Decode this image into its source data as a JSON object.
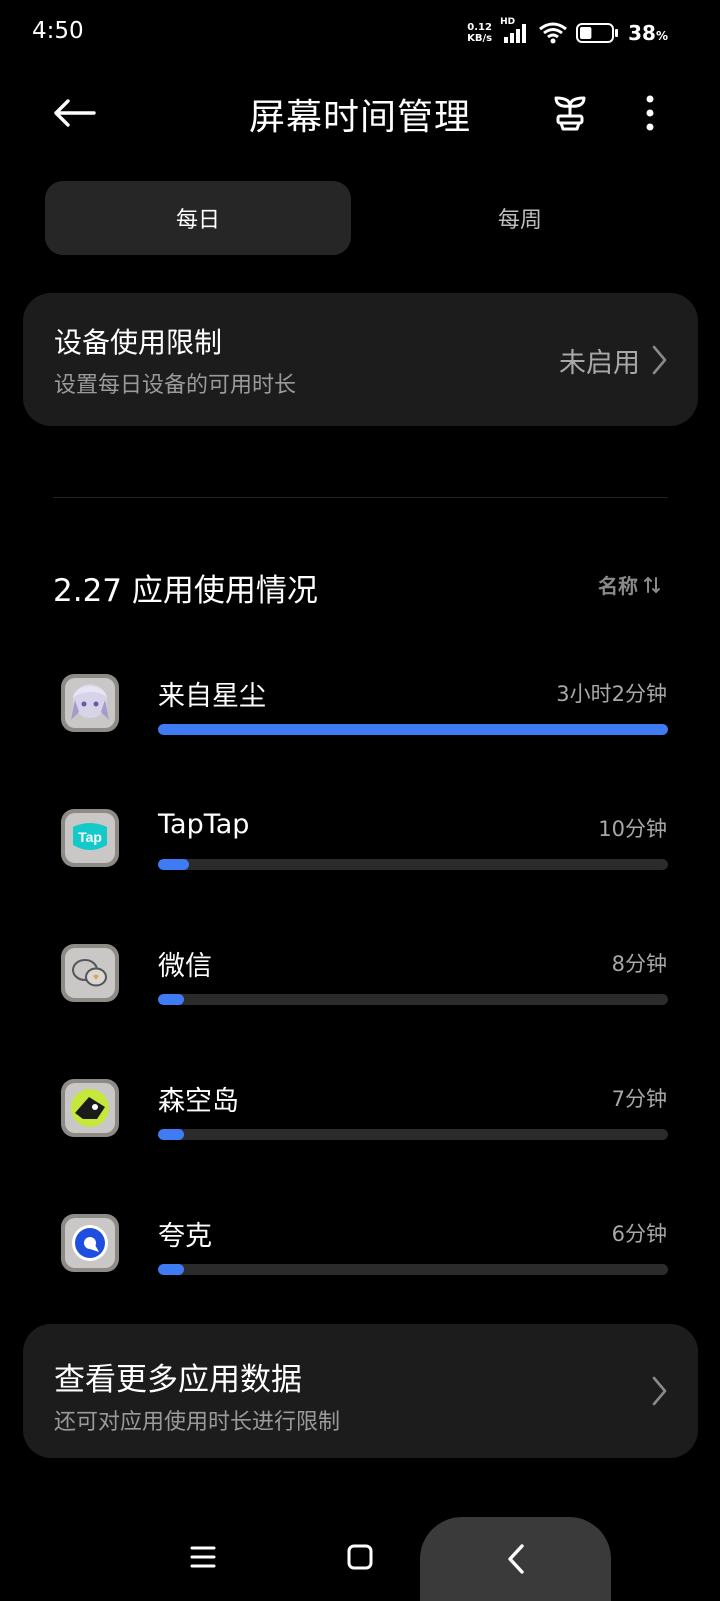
{
  "status_bar": {
    "time": "4:50",
    "net_speed_value": "0.12",
    "net_speed_unit": "KB/s",
    "signal_label": "HD",
    "battery_percent": "38",
    "battery_unit": "%",
    "battery_level": 0.38
  },
  "header": {
    "title": "屏幕时间管理"
  },
  "tabs": [
    {
      "label": "每日",
      "selected": true
    },
    {
      "label": "每周",
      "selected": false
    }
  ],
  "device_limit": {
    "title": "设备使用限制",
    "subtitle": "设置每日设备的可用时长",
    "status": "未启用"
  },
  "usage": {
    "title": "2.27 应用使用情况",
    "sort_label": "名称"
  },
  "apps": [
    {
      "name": "来自星尘",
      "time": "3小时2分钟",
      "fraction": 1.0
    },
    {
      "name": "TapTap",
      "time": "10分钟",
      "fraction": 0.06
    },
    {
      "name": "微信",
      "time": "8分钟",
      "fraction": 0.05
    },
    {
      "name": "森空岛",
      "time": "7分钟",
      "fraction": 0.05
    },
    {
      "name": "夸克",
      "time": "6分钟",
      "fraction": 0.05
    }
  ],
  "more": {
    "title": "查看更多应用数据",
    "subtitle": "还可对应用使用时长进行限制"
  },
  "colors": {
    "accent": "#3f7cf4",
    "background": "#000000",
    "card": "#1c1c1c"
  }
}
